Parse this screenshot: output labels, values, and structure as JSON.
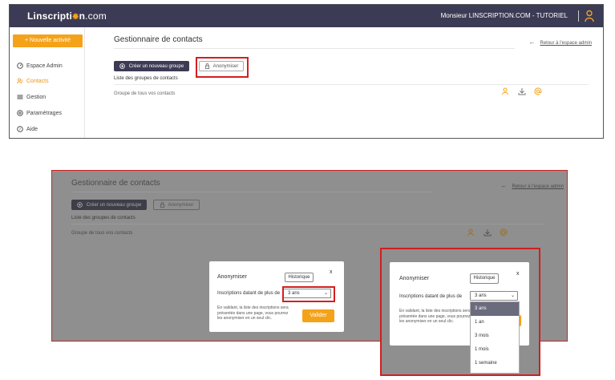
{
  "topbar": {
    "logo_prefix": "Linscripti",
    "logo_suffix": "n",
    "logo_domain": ".com",
    "user_name": "Monsieur LINSCRIPTION.COM - TUTORIEL",
    "bar_separator": "|"
  },
  "sidebar": {
    "new_activity": "+ Nouvelle activité",
    "items": [
      {
        "label": "Espace Admin",
        "icon": "dashboard-icon"
      },
      {
        "label": "Contacts",
        "icon": "contacts-icon"
      },
      {
        "label": "Gestion",
        "icon": "list-icon"
      },
      {
        "label": "Paramètrages",
        "icon": "gear-icon"
      },
      {
        "label": "Aide",
        "icon": "help-icon"
      }
    ]
  },
  "main": {
    "title": "Gestionnaire de contacts",
    "back_link": "Retour à l'espace admin",
    "create_group": "Créer un nouveau groupe",
    "anonymize": "Anonymiser",
    "list_title": "Liste des groupes de contacts",
    "row_label": "Groupe de tous vos contacts"
  },
  "modal": {
    "title": "Anonymiser",
    "history": "Historique",
    "close": "x",
    "label": "Inscriptions datant de plus de",
    "selected": "3 ans",
    "description": "En validant, la liste des inscriptions sera présentée dans une page, vous pourrez les anonymiser en un seul clic.",
    "description_zoom": "En validant, la liste des inscriptions sera présentée dans une page, vous pourrez les anonymiser en un seul clic.",
    "submit": "Valider",
    "options": [
      "3 ans",
      "1 an",
      "3 mois",
      "1 mois",
      "1 semaine"
    ]
  },
  "colors": {
    "accent": "#f5a21b",
    "header": "#3c3b55",
    "highlight": "#d21f1f"
  }
}
